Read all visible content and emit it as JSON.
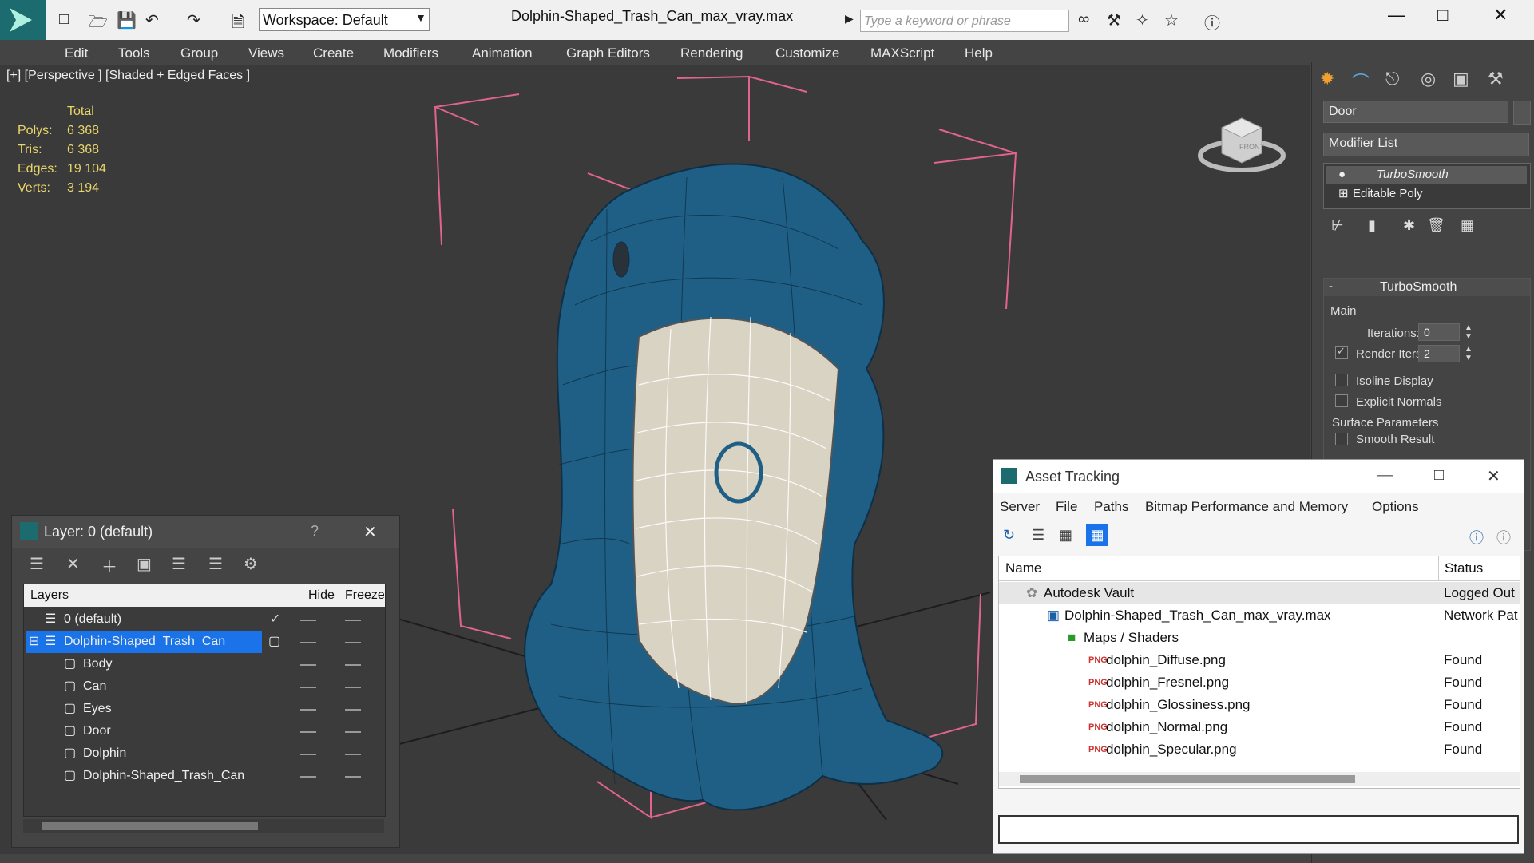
{
  "app": {
    "title": "Dolphin-Shaped_Trash_Can_max_vray.max",
    "workspace": "Workspace: Default",
    "search_placeholder": "Type a keyword or phrase"
  },
  "menus": [
    "Edit",
    "Tools",
    "Group",
    "Views",
    "Create",
    "Modifiers",
    "Animation",
    "Graph Editors",
    "Rendering",
    "Customize",
    "MAXScript",
    "Help"
  ],
  "viewport": {
    "label": "[+] [Perspective ] [Shaded + Edged Faces ]",
    "stats_header": "Total",
    "stats": [
      {
        "label": "Polys:",
        "value": "6 368"
      },
      {
        "label": "Tris:",
        "value": "6 368"
      },
      {
        "label": "Edges:",
        "value": "19 104"
      },
      {
        "label": "Verts:",
        "value": "3 194"
      }
    ],
    "viewcube_label": "FRONT"
  },
  "command_panel": {
    "object_name": "Door",
    "modifier_list": "Modifier List",
    "stack": [
      "TurboSmooth",
      "Editable Poly"
    ],
    "rollout_title": "TurboSmooth",
    "main_group": "Main",
    "iterations_label": "Iterations:",
    "iterations_value": "0",
    "render_iters_label": "Render Iters:",
    "render_iters_value": "2",
    "isoline": "Isoline Display",
    "explicit": "Explicit Normals",
    "surface_params": "Surface Parameters",
    "smooth_result": "Smooth Result"
  },
  "layer_window": {
    "title": "Layer: 0 (default)",
    "help": "?",
    "col_layers": "Layers",
    "col_hide": "Hide",
    "col_freeze": "Freeze",
    "rows": [
      {
        "name": "0 (default)"
      },
      {
        "name": "Dolphin-Shaped_Trash_Can"
      },
      {
        "name": "Body"
      },
      {
        "name": "Can"
      },
      {
        "name": "Eyes"
      },
      {
        "name": "Door"
      },
      {
        "name": "Dolphin"
      },
      {
        "name": "Dolphin-Shaped_Trash_Can"
      }
    ]
  },
  "asset_window": {
    "title": "Asset Tracking",
    "menus": [
      "Server",
      "File",
      "Paths",
      "Bitmap Performance and Memory",
      "Options"
    ],
    "col_name": "Name",
    "col_status": "Status",
    "rows": [
      {
        "name": "Autodesk Vault",
        "status": "Logged Out"
      },
      {
        "name": "Dolphin-Shaped_Trash_Can_max_vray.max",
        "status": "Network Pat"
      },
      {
        "name": "Maps / Shaders",
        "status": ""
      },
      {
        "name": "dolphin_Diffuse.png",
        "status": "Found"
      },
      {
        "name": "dolphin_Fresnel.png",
        "status": "Found"
      },
      {
        "name": "dolphin_Glossiness.png",
        "status": "Found"
      },
      {
        "name": "dolphin_Normal.png",
        "status": "Found"
      },
      {
        "name": "dolphin_Specular.png",
        "status": "Found"
      }
    ]
  },
  "colors": {
    "dolphin": "#1f5f85",
    "can": "#d9d3c4",
    "stats": "#e9d76a",
    "selection": "#1a73e8",
    "bbox": "#e0648c"
  }
}
